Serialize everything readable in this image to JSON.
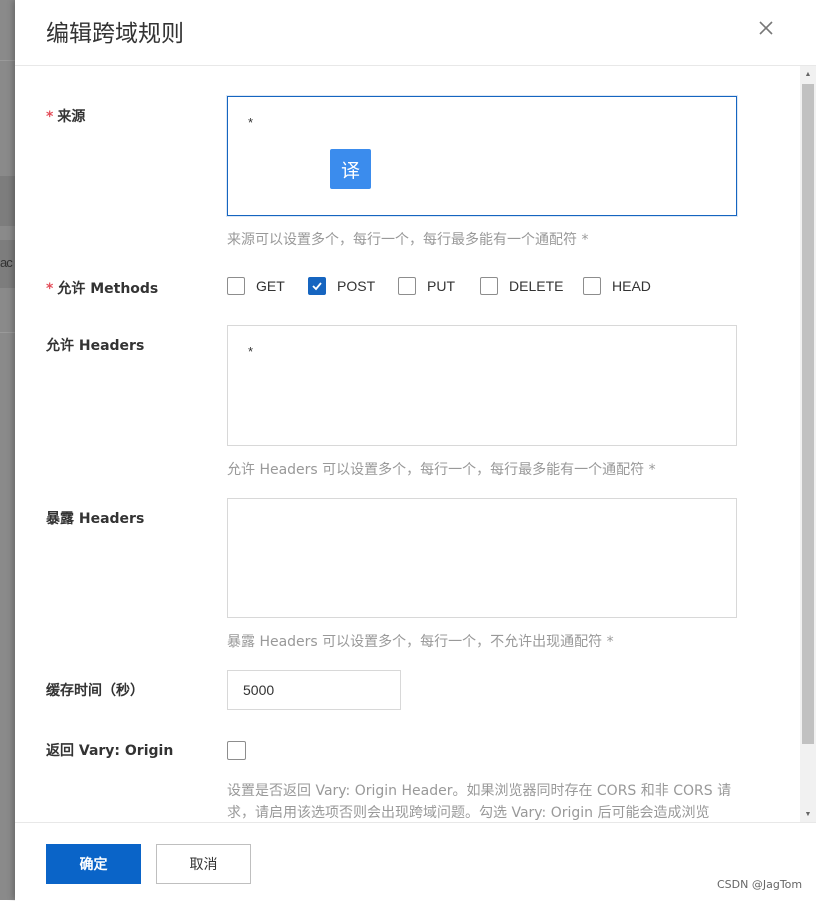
{
  "backdrop": {
    "partial_text": "ac"
  },
  "dialog": {
    "title": "编辑跨域规则"
  },
  "form": {
    "origin": {
      "required_mark": "*",
      "label": "来源",
      "value": "*",
      "hint": "来源可以设置多个，每行一个，每行最多能有一个通配符 *"
    },
    "translate_button": "译",
    "methods": {
      "required_mark": "*",
      "label": "允许 Methods",
      "options": [
        {
          "label": "GET",
          "checked": false
        },
        {
          "label": "POST",
          "checked": true
        },
        {
          "label": "PUT",
          "checked": false
        },
        {
          "label": "DELETE",
          "checked": false
        },
        {
          "label": "HEAD",
          "checked": false
        }
      ]
    },
    "allow_headers": {
      "label": "允许 Headers",
      "value": "*",
      "hint": "允许 Headers 可以设置多个，每行一个，每行最多能有一个通配符 *"
    },
    "expose_headers": {
      "label": "暴露 Headers",
      "value": "",
      "hint": "暴露 Headers 可以设置多个，每行一个，不允许出现通配符 *"
    },
    "cache_time": {
      "label": "缓存时间（秒）",
      "value": "5000"
    },
    "vary_origin": {
      "label": "返回 Vary: Origin",
      "checked": false,
      "hint_line1": "设置是否返回 Vary: Origin Header。如果浏览器同时存在 CORS 和非 CORS 请",
      "hint_line2": "求，请启用该选项否则会出现跨域问题。勾选 Vary: Origin 后可能会造成浏览"
    }
  },
  "footer": {
    "confirm_label": "确定",
    "cancel_label": "取消",
    "watermark": "CSDN @JagTom"
  },
  "colors": {
    "primary": "#0a64c8",
    "required": "#e34d59",
    "translate": "#3b8ced"
  },
  "icons": {
    "close": "close-icon",
    "check": "check-icon",
    "scroll_up": "scroll-up-arrow",
    "scroll_down": "scroll-down-arrow"
  }
}
